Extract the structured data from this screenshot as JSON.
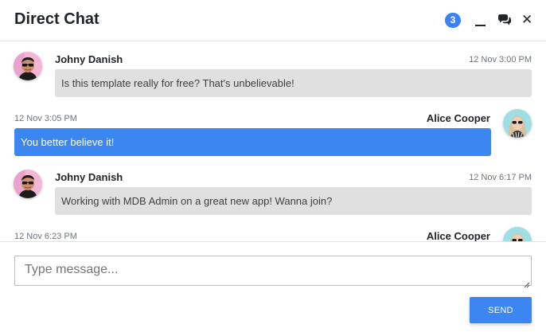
{
  "header": {
    "title": "Direct Chat",
    "badge_count": "3",
    "icons": [
      "minimize-icon",
      "comments-icon",
      "close-icon"
    ]
  },
  "messages": [
    {
      "author": "Johny Danish",
      "time": "12 Nov 3:00 PM",
      "text": "Is this template really for free? That's unbelievable!",
      "side": "left"
    },
    {
      "author": "Alice Cooper",
      "time": "12 Nov 3:05 PM",
      "text": "You better believe it!",
      "side": "right"
    },
    {
      "author": "Johny Danish",
      "time": "12 Nov 6:17 PM",
      "text": "Working with MDB Admin on a great new app! Wanna join?",
      "side": "left"
    },
    {
      "author": "Alice Cooper",
      "time": "12 Nov 6:23 PM",
      "text": "",
      "side": "right"
    }
  ],
  "composer": {
    "placeholder": "Type message...",
    "value": "",
    "send_label": "SEND"
  },
  "colors": {
    "accent": "#3b86f0",
    "incoming_bubble": "#e0e0e0",
    "badge": "#3b82f6"
  }
}
